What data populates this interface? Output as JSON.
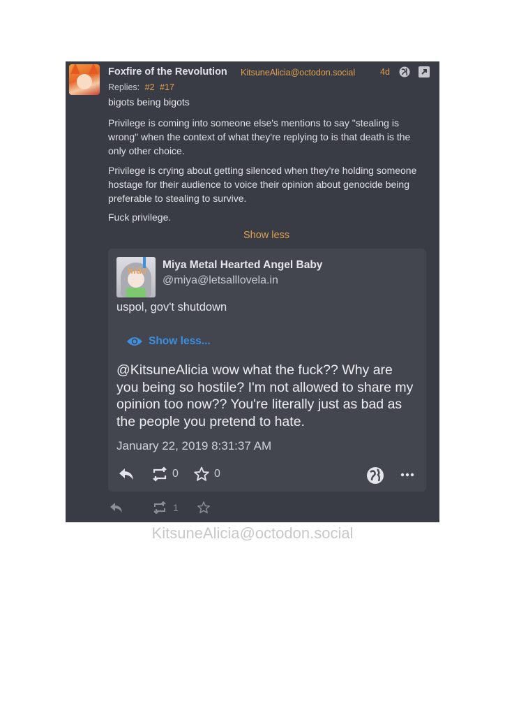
{
  "post": {
    "author_name": "Foxfire of the Revolution",
    "author_handle": "KitsuneAlicia@octodon.social",
    "time": "4d",
    "replies_label": "Replies:",
    "reply_links": [
      "#2",
      "#17"
    ],
    "content_warning": "bigots being bigots",
    "paragraphs": [
      "Privilege is coming into someone else's mentions to say \"stealing is wrong\" when the context of what they're replying to is that death is the only other choice.",
      "Privilege is crying about getting silenced when they're holding someone hostage for their audience to voice their opinion about genocide being preferable to stealing to survive.",
      "Fuck privilege."
    ],
    "show_less": "Show less",
    "boost_count": "1",
    "accent_color": "#e0a050",
    "background_color": "#393c44"
  },
  "quoted": {
    "hide_label": "hide",
    "name": "Miya Metal Hearted Angel Baby",
    "handle": "@miya@letsalllovela.in",
    "content_warning": "uspol, gov't shutdown",
    "show_less": "Show less...",
    "text": "@KitsuneAlicia wow what the fuck?? Why are you being so hostile? I'm not allowed to share my opinion too now?? You're literally just as bad as the people you pretend to hate.",
    "date": "January 22, 2019 8:31:37 AM",
    "boost_count": "0",
    "fav_count": "0",
    "link_color": "#3d8fe0"
  },
  "watermark": "KitsuneAlicia@octodon.social"
}
